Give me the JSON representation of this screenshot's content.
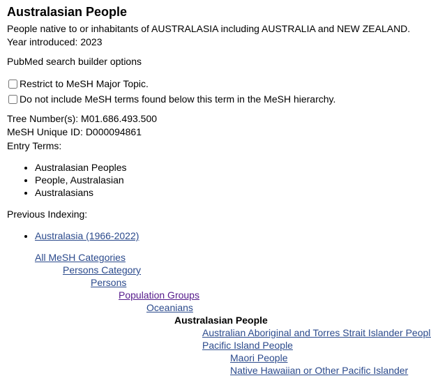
{
  "term": {
    "title": "Australasian People",
    "scope_note": "People native to or inhabitants of AUSTRALASIA including AUSTRALIA and NEW ZEALAND.",
    "year_introduced": "Year introduced: 2023"
  },
  "search_builder": {
    "heading": "PubMed search builder options",
    "options": [
      {
        "label": "Restrict to MeSH Major Topic.",
        "checked": false
      },
      {
        "label": "Do not include MeSH terms found below this term in the MeSH hierarchy.",
        "checked": false
      }
    ]
  },
  "identifiers": {
    "tree_numbers": "Tree Number(s): M01.686.493.500",
    "unique_id": "MeSH Unique ID: D000094861",
    "entry_terms_heading": "Entry Terms:"
  },
  "entry_terms": [
    "Australasian Peoples",
    "People, Australasian",
    "Australasians"
  ],
  "previous_indexing": {
    "heading": "Previous Indexing:",
    "items": [
      "Australasia (1966-2022)"
    ]
  },
  "tree": [
    {
      "label": "All MeSH Categories",
      "level": 0,
      "type": "link"
    },
    {
      "label": "Persons Category",
      "level": 1,
      "type": "link"
    },
    {
      "label": "Persons",
      "level": 2,
      "type": "link"
    },
    {
      "label": "Population Groups",
      "level": 3,
      "type": "visited"
    },
    {
      "label": "Oceanians",
      "level": 4,
      "type": "link"
    },
    {
      "label": "Australasian People",
      "level": 5,
      "type": "current"
    },
    {
      "label": "Australian Aboriginal and Torres Strait Islander Peoples",
      "level": 6,
      "type": "link"
    },
    {
      "label": "Pacific Island People",
      "level": 6,
      "type": "link"
    },
    {
      "label": "Maori People",
      "level": 7,
      "type": "link"
    },
    {
      "label": "Native Hawaiian or Other Pacific Islander",
      "level": 7,
      "type": "link"
    }
  ],
  "colors": {
    "link": "#2b4a8c",
    "visited": "#551a8b",
    "text": "#000000"
  }
}
